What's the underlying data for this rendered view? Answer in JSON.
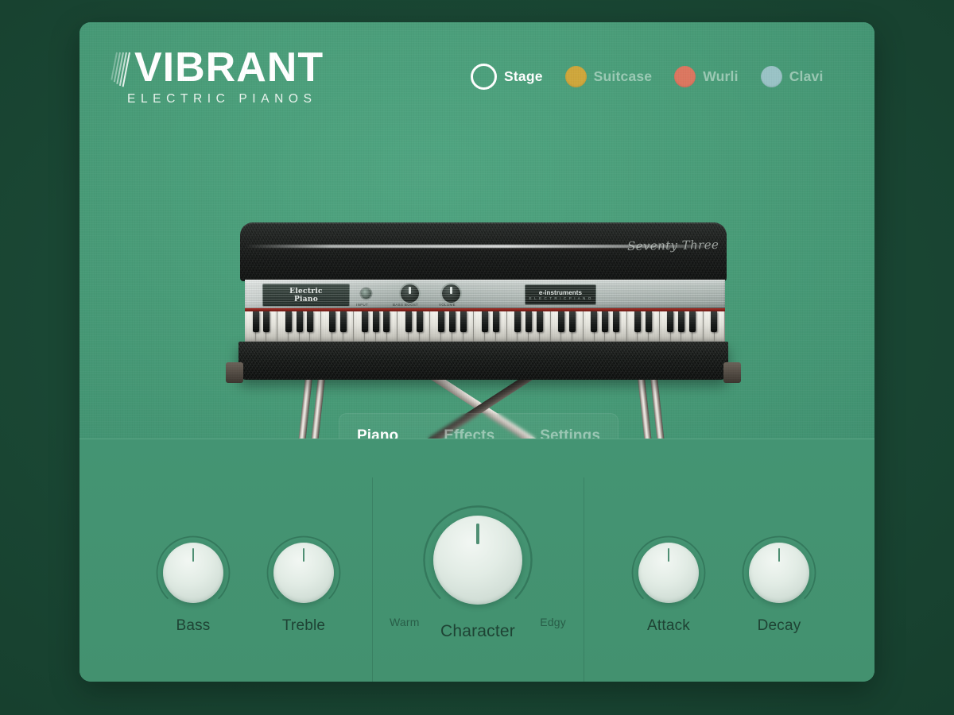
{
  "app": {
    "brand_name": "VIBRANT",
    "brand_tagline": "ELECTRIC PIANOS",
    "panel_color": "#479b77",
    "desk_color": "#1a4734"
  },
  "presets": {
    "items": [
      {
        "label": "Stage",
        "color": "#ffffff",
        "style": "ring",
        "active": true
      },
      {
        "label": "Suitcase",
        "color": "#cfa73c",
        "style": "filled",
        "active": false
      },
      {
        "label": "Wurli",
        "color": "#dc7760",
        "style": "filled",
        "active": false
      },
      {
        "label": "Clavi",
        "color": "#9ac3c6",
        "style": "filled",
        "active": false
      }
    ]
  },
  "instrument": {
    "nameplate_line1": "Electric",
    "nameplate_line2": "Piano",
    "badge_name": "e-instruments",
    "badge_sub": "E L E C T R I C   P I A N O",
    "lid_script": "Seventy Three",
    "control_micro_1": "INPUT",
    "control_micro_2": "BASS BOOST",
    "control_micro_3": "VOLUME"
  },
  "tabs": {
    "items": [
      {
        "label": "Piano",
        "active": true
      },
      {
        "label": "Effects",
        "active": false
      },
      {
        "label": "Settings",
        "active": false
      }
    ]
  },
  "controls": {
    "knobs": [
      {
        "name": "Bass",
        "value": 50,
        "size": "small"
      },
      {
        "name": "Treble",
        "value": 50,
        "size": "small"
      },
      {
        "name": "Character",
        "value": 50,
        "size": "large",
        "min_label": "Warm",
        "max_label": "Edgy"
      },
      {
        "name": "Attack",
        "value": 50,
        "size": "small"
      },
      {
        "name": "Decay",
        "value": 50,
        "size": "small"
      }
    ]
  }
}
